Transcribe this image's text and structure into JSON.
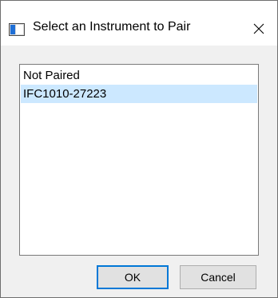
{
  "window": {
    "title": "Select an Instrument to Pair",
    "accent_color": "#0078d7",
    "selection_color": "#cce8ff"
  },
  "icons": {
    "app": "app-window-icon",
    "close": "close-icon"
  },
  "list": {
    "items": [
      {
        "label": "Not Paired",
        "selected": false
      },
      {
        "label": "IFC1010-27223",
        "selected": true
      }
    ]
  },
  "buttons": {
    "ok_label": "OK",
    "cancel_label": "Cancel"
  }
}
